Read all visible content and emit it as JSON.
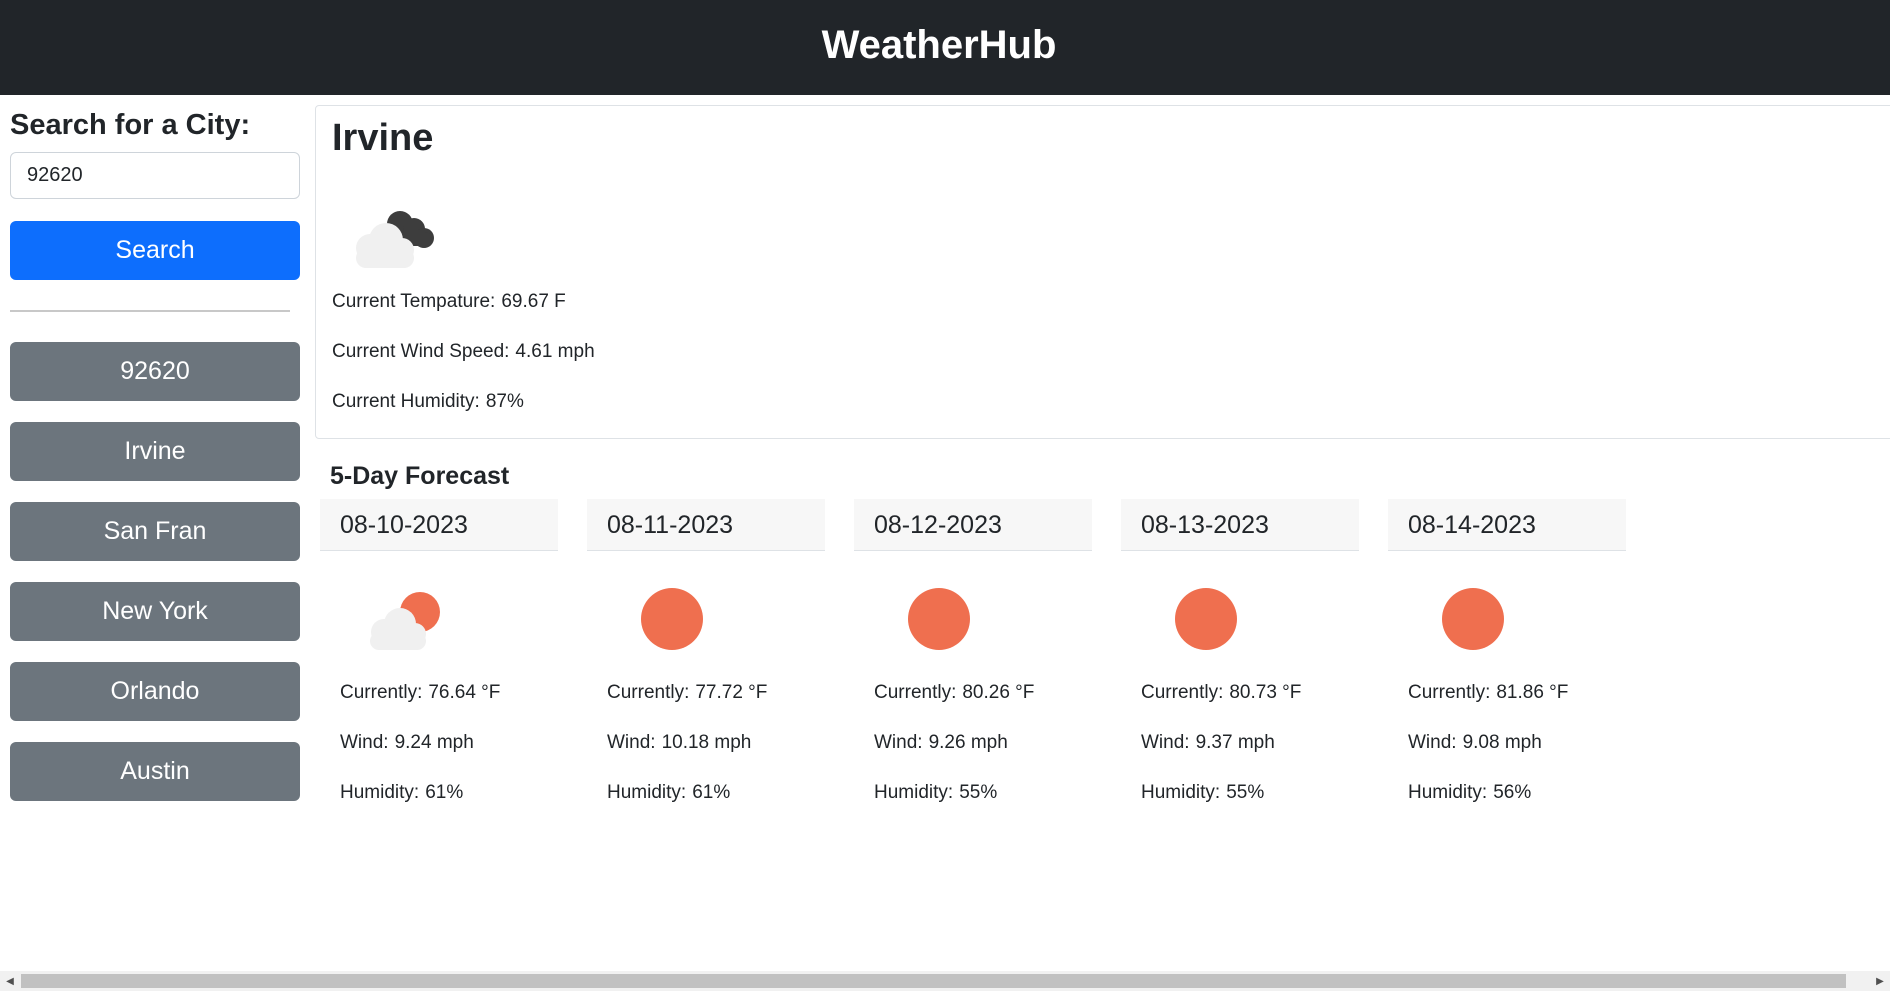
{
  "app": {
    "title": "WeatherHub"
  },
  "search": {
    "label": "Search for a City:",
    "value": "92620",
    "button_label": "Search"
  },
  "history": [
    "92620",
    "Irvine",
    "San Fran",
    "New York",
    "Orlando",
    "Austin"
  ],
  "current": {
    "city": "Irvine",
    "icon": "broken-clouds-icon",
    "temperature_label": "Current Tempature:",
    "temperature_value": "69.67 F",
    "wind_label": "Current Wind Speed:",
    "wind_value": "4.61 mph",
    "humidity_label": "Current Humidity:",
    "humidity_value": "87%"
  },
  "forecast": {
    "title": "5-Day Forecast",
    "days": [
      {
        "date": "08-10-2023",
        "icon": "partly-cloudy-icon",
        "temp_label": "Currently:",
        "temp": "76.64 °F",
        "wind_label": "Wind:",
        "wind": "9.24 mph",
        "humidity_label": "Humidity:",
        "humidity": "61%"
      },
      {
        "date": "08-11-2023",
        "icon": "sun-icon",
        "temp_label": "Currently:",
        "temp": "77.72 °F",
        "wind_label": "Wind:",
        "wind": "10.18 mph",
        "humidity_label": "Humidity:",
        "humidity": "61%"
      },
      {
        "date": "08-12-2023",
        "icon": "sun-icon",
        "temp_label": "Currently:",
        "temp": "80.26 °F",
        "wind_label": "Wind:",
        "wind": "9.26 mph",
        "humidity_label": "Humidity:",
        "humidity": "55%"
      },
      {
        "date": "08-13-2023",
        "icon": "sun-icon",
        "temp_label": "Currently:",
        "temp": "80.73 °F",
        "wind_label": "Wind:",
        "wind": "9.37 mph",
        "humidity_label": "Humidity:",
        "humidity": "55%"
      },
      {
        "date": "08-14-2023",
        "icon": "sun-icon",
        "temp_label": "Currently:",
        "temp": "81.86 °F",
        "wind_label": "Wind:",
        "wind": "9.08 mph",
        "humidity_label": "Humidity:",
        "humidity": "56%"
      }
    ]
  },
  "colors": {
    "header_bg": "#212529",
    "primary": "#0d6efd",
    "secondary": "#6c757d",
    "sun": "#ef6f4f",
    "cloud_light": "#f0f0f0",
    "cloud_dark": "#3d3d3d"
  }
}
